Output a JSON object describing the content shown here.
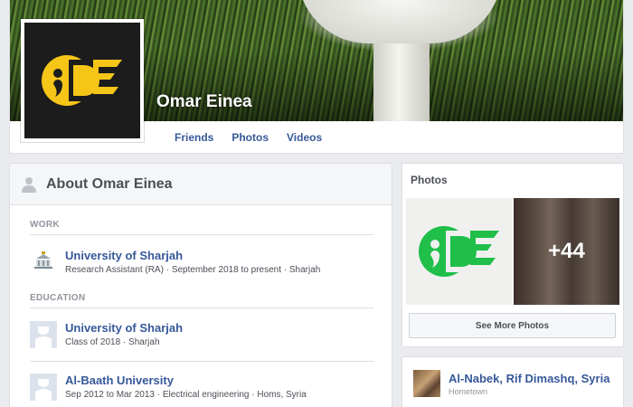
{
  "profile": {
    "name": "Omar Einea",
    "tabs": [
      "Friends",
      "Photos",
      "Videos"
    ]
  },
  "about": {
    "title": "About Omar Einea",
    "work_label": "WORK",
    "education_label": "EDUCATION",
    "work": [
      {
        "name": "University of Sharjah",
        "detail": "Research Assistant (RA) · September 2018 to present · Sharjah"
      }
    ],
    "education": [
      {
        "name": "University of Sharjah",
        "detail": "Class of 2018 · Sharjah"
      },
      {
        "name": "Al-Baath University",
        "detail": "Sep 2012 to Mar 2013 · Electrical engineering · Homs, Syria"
      }
    ]
  },
  "photos": {
    "title": "Photos",
    "more_count": "+44",
    "see_more": "See More Photos"
  },
  "place": {
    "name": "Al-Nabek, Rif Dimashq, Syria",
    "label": "Hometown"
  },
  "colors": {
    "link": "#365899",
    "logo_yellow": "#f5c518",
    "logo_green": "#1fbf4a"
  }
}
